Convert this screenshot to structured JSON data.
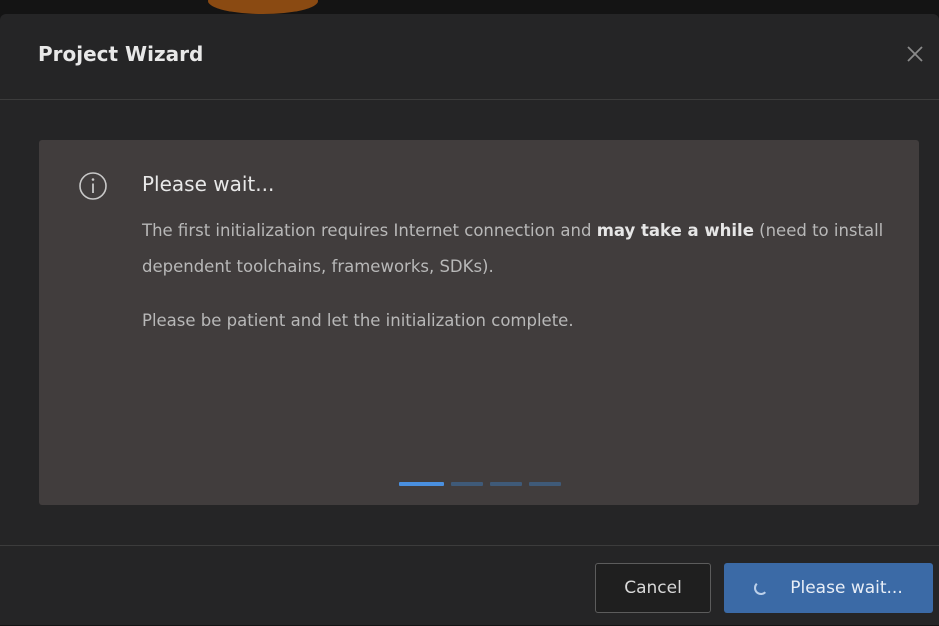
{
  "dialog": {
    "title": "Project Wizard",
    "close_icon": "close-icon"
  },
  "notice": {
    "icon": "info-icon",
    "title": "Please wait...",
    "line1_prefix": "The first initialization requires Internet connection and ",
    "line1_bold": "may take a while",
    "line1_suffix": " (need to install dependent toolchains, frameworks, SDKs).",
    "line2": "Please be patient and let the initialization complete.",
    "progress_steps": 4,
    "progress_active_step": 1
  },
  "footer": {
    "cancel_label": "Cancel",
    "primary_label": "Please wait...",
    "primary_icon": "spinner-icon"
  },
  "colors": {
    "accent": "#3b6aa6",
    "progress_active": "#4a90e0",
    "progress_inactive": "#3f5a78"
  }
}
